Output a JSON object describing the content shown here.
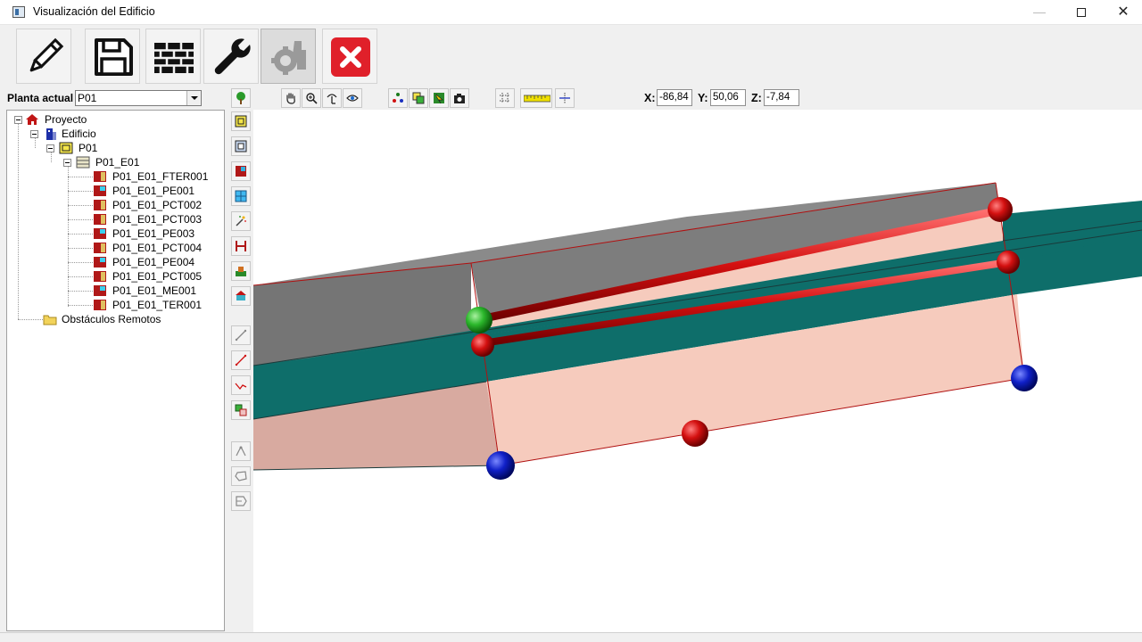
{
  "window": {
    "title": "Visualización del Edificio",
    "minimize": "—",
    "close": "✕"
  },
  "toolbar": {
    "buttons": [
      {
        "name": "edit",
        "icon": "pencil-icon"
      },
      {
        "name": "save",
        "icon": "floppy-disk-icon"
      },
      {
        "name": "walls",
        "icon": "brick-wall-icon"
      },
      {
        "name": "settings",
        "icon": "wrench-icon"
      },
      {
        "name": "tool-disabled",
        "icon": "gear-hand-icon"
      },
      {
        "name": "close",
        "icon": "close-x-icon"
      }
    ]
  },
  "floor_selector": {
    "label": "Planta actual",
    "value": "P01"
  },
  "tree": {
    "root": "Proyecto",
    "building": "Edificio",
    "floor": "P01",
    "space": "P01_E01",
    "elements": [
      "P01_E01_FTER001",
      "P01_E01_PE001",
      "P01_E01_PCT002",
      "P01_E01_PCT003",
      "P01_E01_PE003",
      "P01_E01_PCT004",
      "P01_E01_PE004",
      "P01_E01_PCT005",
      "P01_E01_ME001",
      "P01_E01_TER001"
    ],
    "remote": "Obstáculos Remotos"
  },
  "coordinates": {
    "x_label": "X:",
    "x_value": "-86,84",
    "y_label": "Y:",
    "y_value": "50,06",
    "z_label": "Z:",
    "z_value": "-7,84"
  },
  "colors": {
    "accent_red": "#e0202a",
    "roof_gray": "#7a7a7a",
    "teal_plane": "#0e6e6a",
    "wall_pink": "#f6cbbd",
    "node_red": "#d41010",
    "node_blue": "#1020c8",
    "node_green": "#2cb82c"
  }
}
